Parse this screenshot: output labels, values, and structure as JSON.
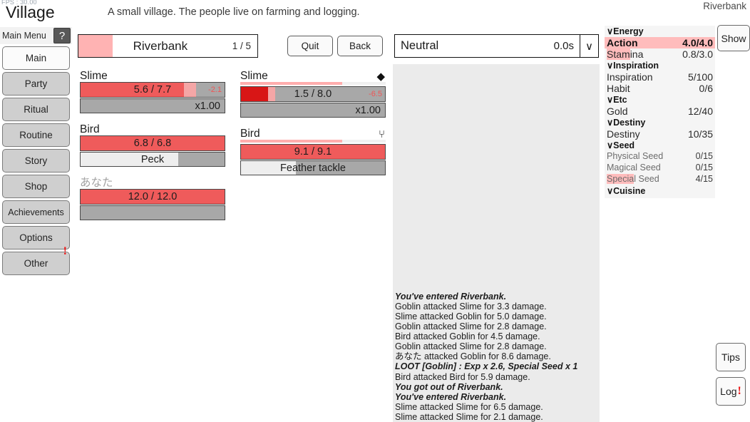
{
  "app": {
    "fps": "FPS : 30.00",
    "title": "Village",
    "subtitle": "A small village. The people live on farming and logging.",
    "zone_label": "Riverbank"
  },
  "sidebar": {
    "header_label": "Main Menu",
    "help_label": "?",
    "items": [
      {
        "label": "Main",
        "selected": true
      },
      {
        "label": "Party",
        "selected": false
      },
      {
        "label": "Ritual",
        "selected": false
      },
      {
        "label": "Routine",
        "selected": false
      },
      {
        "label": "Story",
        "selected": false
      },
      {
        "label": "Shop",
        "selected": false
      },
      {
        "label": "Achievements",
        "selected": false
      },
      {
        "label": "Options",
        "selected": false
      },
      {
        "label": "Other",
        "selected": false,
        "badge": "!"
      }
    ]
  },
  "battle_header": {
    "zone_name": "Riverbank",
    "zone_count": "1 / 5",
    "zone_progress_pct": 19,
    "quit_label": "Quit",
    "back_label": "Back",
    "state_name": "Neutral",
    "state_time": "0.0s",
    "state_caret": "∨"
  },
  "party_left": {
    "units": [
      {
        "name": "Slime",
        "dim": false,
        "icon": "",
        "aggro_pct": 0,
        "show_aggro": false,
        "hp_text": "5.6 / 7.7",
        "hp_pct": 72,
        "hp_ghost_pct": 8,
        "hp_deep": false,
        "delta": "-2.1",
        "bottom_text": "x1.00",
        "bottom_align": "right",
        "bottom_fill_pct": 0
      },
      {
        "name": "Bird",
        "dim": false,
        "icon": "",
        "aggro_pct": 0,
        "show_aggro": false,
        "hp_text": "6.8 / 6.8",
        "hp_pct": 100,
        "hp_ghost_pct": 0,
        "hp_deep": false,
        "delta": "",
        "bottom_text": "Peck",
        "bottom_align": "center",
        "bottom_fill_pct": 68
      },
      {
        "name": "あなた",
        "dim": true,
        "icon": "",
        "aggro_pct": 0,
        "show_aggro": false,
        "hp_text": "12.0 / 12.0",
        "hp_pct": 100,
        "hp_ghost_pct": 0,
        "hp_deep": false,
        "delta": "",
        "bottom_text": "",
        "bottom_align": "center",
        "bottom_fill_pct": 0
      }
    ]
  },
  "party_right": {
    "units": [
      {
        "name": "Slime",
        "dim": false,
        "icon": "◆",
        "icon_name": "droplet-icon",
        "aggro_pct": 70,
        "show_aggro": true,
        "hp_text": "1.5 / 8.0",
        "hp_pct": 19,
        "hp_ghost_pct": 5,
        "hp_deep": true,
        "delta": "-6.5",
        "bottom_text": "x1.00",
        "bottom_align": "right",
        "bottom_fill_pct": 0
      },
      {
        "name": "Bird",
        "dim": false,
        "icon": "⑂",
        "icon_name": "wind-icon",
        "aggro_pct": 70,
        "show_aggro": true,
        "hp_text": "9.1 / 9.1",
        "hp_pct": 100,
        "hp_ghost_pct": 0,
        "hp_deep": false,
        "delta": "",
        "bottom_text": "Feather tackle",
        "bottom_align": "center",
        "bottom_fill_pct": 38
      }
    ]
  },
  "log": {
    "lines": [
      {
        "text": "You've entered Riverbank.",
        "style": "evt"
      },
      {
        "text": "Goblin attacked Slime for 3.3 damage.",
        "style": "normal"
      },
      {
        "text": "Slime attacked Goblin for 5.0 damage.",
        "style": "normal"
      },
      {
        "text": "Goblin attacked Slime for 2.8 damage.",
        "style": "normal"
      },
      {
        "text": "Bird attacked Goblin for 4.5 damage.",
        "style": "normal"
      },
      {
        "text": "Goblin attacked Slime for 2.8 damage.",
        "style": "normal"
      },
      {
        "text": "あなた attacked Goblin for 8.6 damage.",
        "style": "normal"
      },
      {
        "text": "LOOT [Goblin] : Exp x 2.6, Special Seed x 1",
        "style": "evt"
      },
      {
        "text": "Bird attacked Bird for 5.9 damage.",
        "style": "normal"
      },
      {
        "text": "You got out of Riverbank.",
        "style": "evt"
      },
      {
        "text": "You've entered Riverbank.",
        "style": "evt"
      },
      {
        "text": "Slime attacked Slime for 6.5 damage.",
        "style": "normal"
      },
      {
        "text": "Slime attacked Slime for 2.1 damage.",
        "style": "normal"
      }
    ]
  },
  "stats": {
    "rows": [
      {
        "kind": "group",
        "label": "∨Energy"
      },
      {
        "kind": "stat",
        "label": "Action",
        "value": "4.0/4.0",
        "bold": true,
        "row_highlight_pct": 100
      },
      {
        "kind": "stat",
        "label": "Stamina",
        "value": "0.8/3.0",
        "bold": false,
        "mark_highlight_pct": 62
      },
      {
        "kind": "group",
        "label": "∨Inspiration"
      },
      {
        "kind": "stat",
        "label": "Inspiration",
        "value": "5/100",
        "bold": false
      },
      {
        "kind": "stat",
        "label": "Habit",
        "value": "0/6",
        "bold": false
      },
      {
        "kind": "group",
        "label": "∨Etc"
      },
      {
        "kind": "stat",
        "label": "Gold",
        "value": "12/40",
        "bold": false
      },
      {
        "kind": "group",
        "label": "∨Destiny"
      },
      {
        "kind": "stat",
        "label": "Destiny",
        "value": "10/35",
        "bold": false
      },
      {
        "kind": "group",
        "label": "∨Seed"
      },
      {
        "kind": "stat",
        "label": "Physical Seed",
        "value": "0/15",
        "small": true
      },
      {
        "kind": "stat",
        "label": "Magical Seed",
        "value": "0/15",
        "small": true
      },
      {
        "kind": "stat",
        "label": "Special Seed",
        "value": "4/15",
        "small": true,
        "mark_highlight_pct": 48
      },
      {
        "kind": "group",
        "label": "∨Cuisine"
      }
    ]
  },
  "side_buttons": {
    "show_label": "Show",
    "tips_label": "Tips",
    "log_label": "Log",
    "log_badge": "!"
  },
  "colors": {
    "hp_fill": "#ef5b5b",
    "hp_fill_deep": "#d81616",
    "hp_ghost": "#f4a6a6",
    "bar_empty": "#a8a8a8",
    "highlight_pink": "#ffbcbc",
    "zone_progress": "#ffb3b3",
    "alert_red": "#ee1111",
    "panel_bg": "#ebebeb",
    "stats_bg": "#f5f5f5"
  }
}
